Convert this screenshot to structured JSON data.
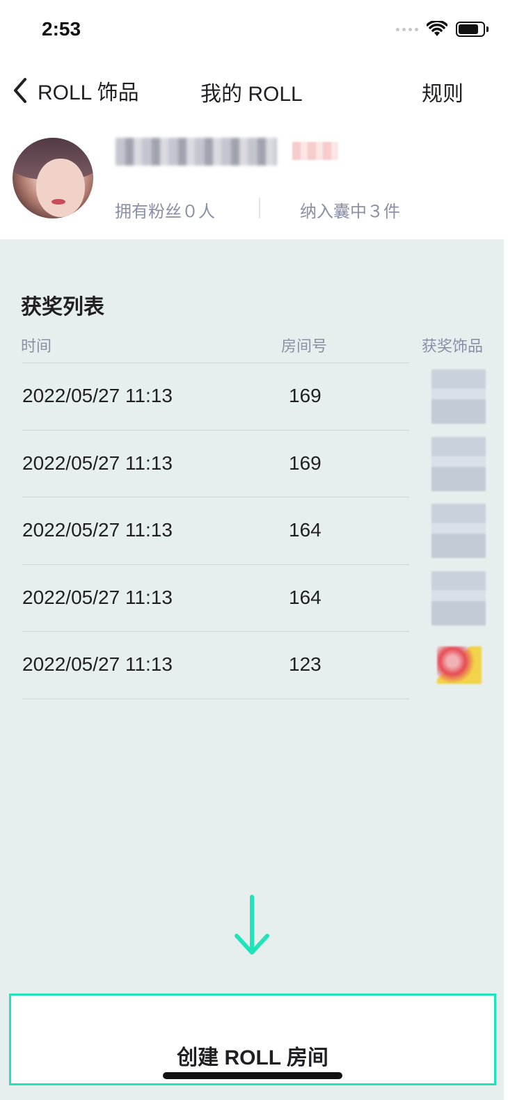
{
  "status_bar": {
    "time": "2:53"
  },
  "nav": {
    "back_label": "ROLL 饰品",
    "title": "我的 ROLL",
    "rules_label": "规则"
  },
  "profile": {
    "username": "",
    "fans_text": "拥有粉丝０人",
    "bag_text": "纳入囊中３件"
  },
  "prize_list": {
    "title": "获奖列表",
    "columns": {
      "time": "时间",
      "room": "房间号",
      "item": "获奖饰品"
    },
    "rows": [
      {
        "time": "2022/05/27 11:13",
        "room": "169",
        "item_icon": "item-thumbnail-icon"
      },
      {
        "time": "2022/05/27 11:13",
        "room": "169",
        "item_icon": "item-thumbnail-icon"
      },
      {
        "time": "2022/05/27 11:13",
        "room": "164",
        "item_icon": "item-thumbnail-icon"
      },
      {
        "time": "2022/05/27 11:13",
        "room": "164",
        "item_icon": "item-thumbnail-icon"
      },
      {
        "time": "2022/05/27 11:13",
        "room": "123",
        "item_icon": "item-thumbnail-icon"
      }
    ]
  },
  "bottom": {
    "create_label": "创建 ROLL 房间"
  },
  "colors": {
    "accent": "#21e3b9",
    "page_bg": "#e7efee",
    "muted_text": "#8a8fa6",
    "text": "#1f1f24"
  }
}
